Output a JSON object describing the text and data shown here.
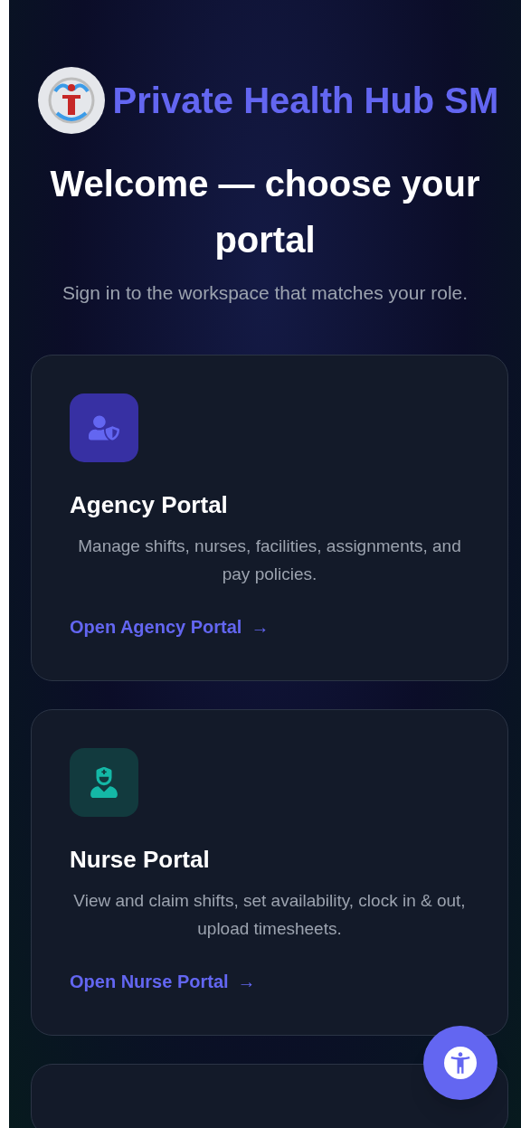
{
  "header": {
    "title": "Private Health Hub SM"
  },
  "hero": {
    "heading": "Welcome — choose your portal",
    "subtitle": "Sign in to the workspace that matches your role."
  },
  "cards": [
    {
      "kind": "agency",
      "title": "Agency Portal",
      "description": "Manage shifts, nurses, facilities, assignments, and pay policies.",
      "link": "Open Agency Portal",
      "link_icon": "→",
      "color": "#6366f1"
    },
    {
      "kind": "nurse",
      "title": "Nurse Portal",
      "description": "View and claim shifts, set availability, clock in & out, upload timesheets.",
      "link": "Open Nurse Portal",
      "link_icon": "→",
      "color": "#14b8a6"
    }
  ]
}
